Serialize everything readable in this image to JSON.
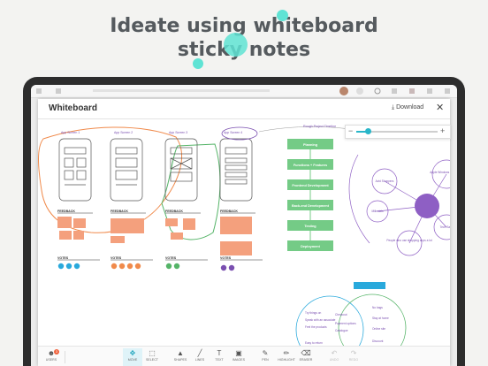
{
  "headline": {
    "line1": "Ideate using whiteboard",
    "line2": "sticky notes"
  },
  "colors": {
    "accent": "#29b6c9",
    "sticky": "#f4a07d",
    "process": "#74cb86",
    "hub": "#8e5fc4",
    "dark": "#2d2d2d"
  },
  "whiteboard": {
    "title": "Whiteboard",
    "download_label": "Download",
    "close_icon": "close-icon",
    "zoom": {
      "minus": "−",
      "plus": "+",
      "level": 0.13
    },
    "screens": [
      {
        "label": "App Screen 1",
        "section": "FEEDBACK",
        "votes": "VOTES"
      },
      {
        "label": "App Screen 2",
        "section": "FEEDBACK",
        "votes": "VOTES"
      },
      {
        "label": "App Screen 3",
        "section": "FEEDBACK",
        "votes": "VOTES"
      },
      {
        "label": "App Screen 4",
        "section": "FEEDBACK",
        "votes": "VOTES"
      }
    ],
    "timeline": {
      "title": "Rough Project Timeline",
      "steps": [
        "Planning",
        "Functions + Features",
        "Frontend Development",
        "Back-end Development",
        "Testing",
        "Deployment"
      ]
    },
    "mindmap": {
      "nodes": [
        "Apple Windows Workflows",
        "Avid Shoppers",
        "Millenials",
        "People who use shopping apps a lot",
        "Tech Savy"
      ]
    },
    "venn": {
      "left": [
        "Try things on",
        "Speak with an associate",
        "Feel the products",
        "Easy to return"
      ],
      "center": [
        "Checkout",
        "Payment options",
        "Catalogue"
      ],
      "right": [
        "No bags",
        "Stay at home",
        "Online site",
        "Discount"
      ]
    },
    "toolbar": [
      {
        "label": "USERS",
        "icon": "users-icon"
      },
      {
        "label": "MOVE",
        "icon": "move-icon"
      },
      {
        "label": "SELECT",
        "icon": "select-icon"
      },
      {
        "label": "SHAPES",
        "icon": "shapes-icon"
      },
      {
        "label": "LINES",
        "icon": "lines-icon"
      },
      {
        "label": "TEXT",
        "icon": "text-icon"
      },
      {
        "label": "IMAGES",
        "icon": "images-icon"
      },
      {
        "label": "PEN",
        "icon": "pen-icon"
      },
      {
        "label": "HIGHLIGHT",
        "icon": "highlight-icon"
      },
      {
        "label": "ERASER",
        "icon": "eraser-icon"
      },
      {
        "label": "UNDO",
        "icon": "undo-icon"
      },
      {
        "label": "REDO",
        "icon": "redo-icon"
      }
    ],
    "users_badge": "3"
  }
}
